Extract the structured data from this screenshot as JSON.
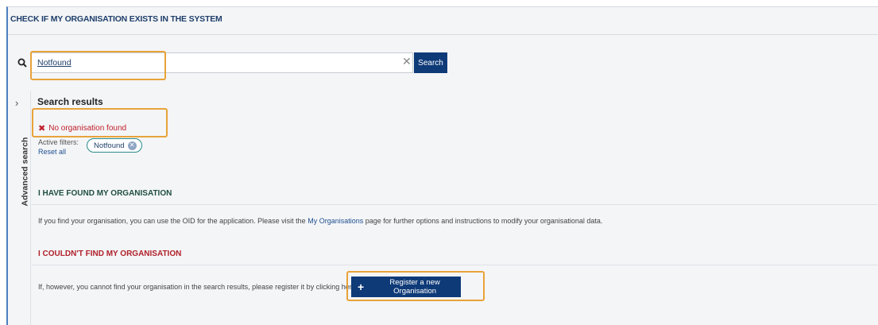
{
  "section_title": "CHECK IF MY ORGANISATION EXISTS IN THE SYSTEM",
  "search": {
    "value": "Notfound",
    "clear_icon": "✕",
    "button_label": "Search",
    "icon": "search-icon"
  },
  "advanced_search": {
    "label": "Advanced search",
    "chevron": "›"
  },
  "results": {
    "title": "Search results",
    "status_icon": "✖",
    "status_text": "No organisation found",
    "active_filters_label": "Active filters:",
    "reset_label": "Reset all",
    "filter_chip": "Notfound",
    "chip_remove_icon": "✕"
  },
  "found": {
    "heading": "I HAVE FOUND MY ORGANISATION",
    "text_before": "If you find your organisation, you can use the OID for the application. Please visit the ",
    "link": "My Organisations",
    "text_after": " page for further options and instructions to modify your organisational data."
  },
  "not_found": {
    "heading": "I COULDN'T FIND MY ORGANISATION",
    "text": "If, however, you cannot find your organisation in the search results, please register it by clicking here",
    "button_icon": "+",
    "button_label": "Register a new Organisation"
  },
  "colors": {
    "primary_button": "#0e3a78",
    "highlight": "#e8a33a",
    "error": "#c0202a"
  }
}
